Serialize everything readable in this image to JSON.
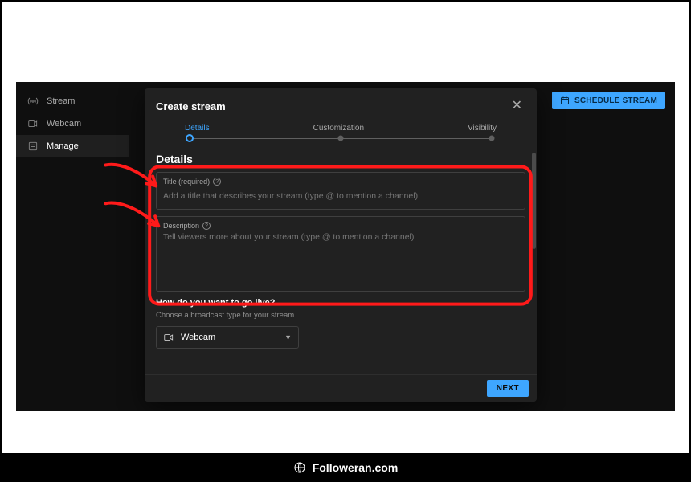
{
  "sidebar": {
    "items": [
      {
        "label": "Stream"
      },
      {
        "label": "Webcam"
      },
      {
        "label": "Manage"
      }
    ]
  },
  "header": {
    "schedule_label": "SCHEDULE STREAM"
  },
  "modal": {
    "title": "Create stream",
    "steps": {
      "details": "Details",
      "customization": "Customization",
      "visibility": "Visibility"
    },
    "section_heading": "Details",
    "title_field": {
      "label": "Title (required)",
      "placeholder": "Add a title that describes your stream (type @ to mention a channel)"
    },
    "desc_field": {
      "label": "Description",
      "placeholder": "Tell viewers more about your stream (type @ to mention a channel)"
    },
    "go_live_question": "How do you want to go live?",
    "go_live_hint": "Choose a broadcast type for your stream",
    "broadcast_select": {
      "value": "Webcam"
    },
    "next_label": "NEXT"
  },
  "watermark": {
    "text": "Followeran.com"
  }
}
